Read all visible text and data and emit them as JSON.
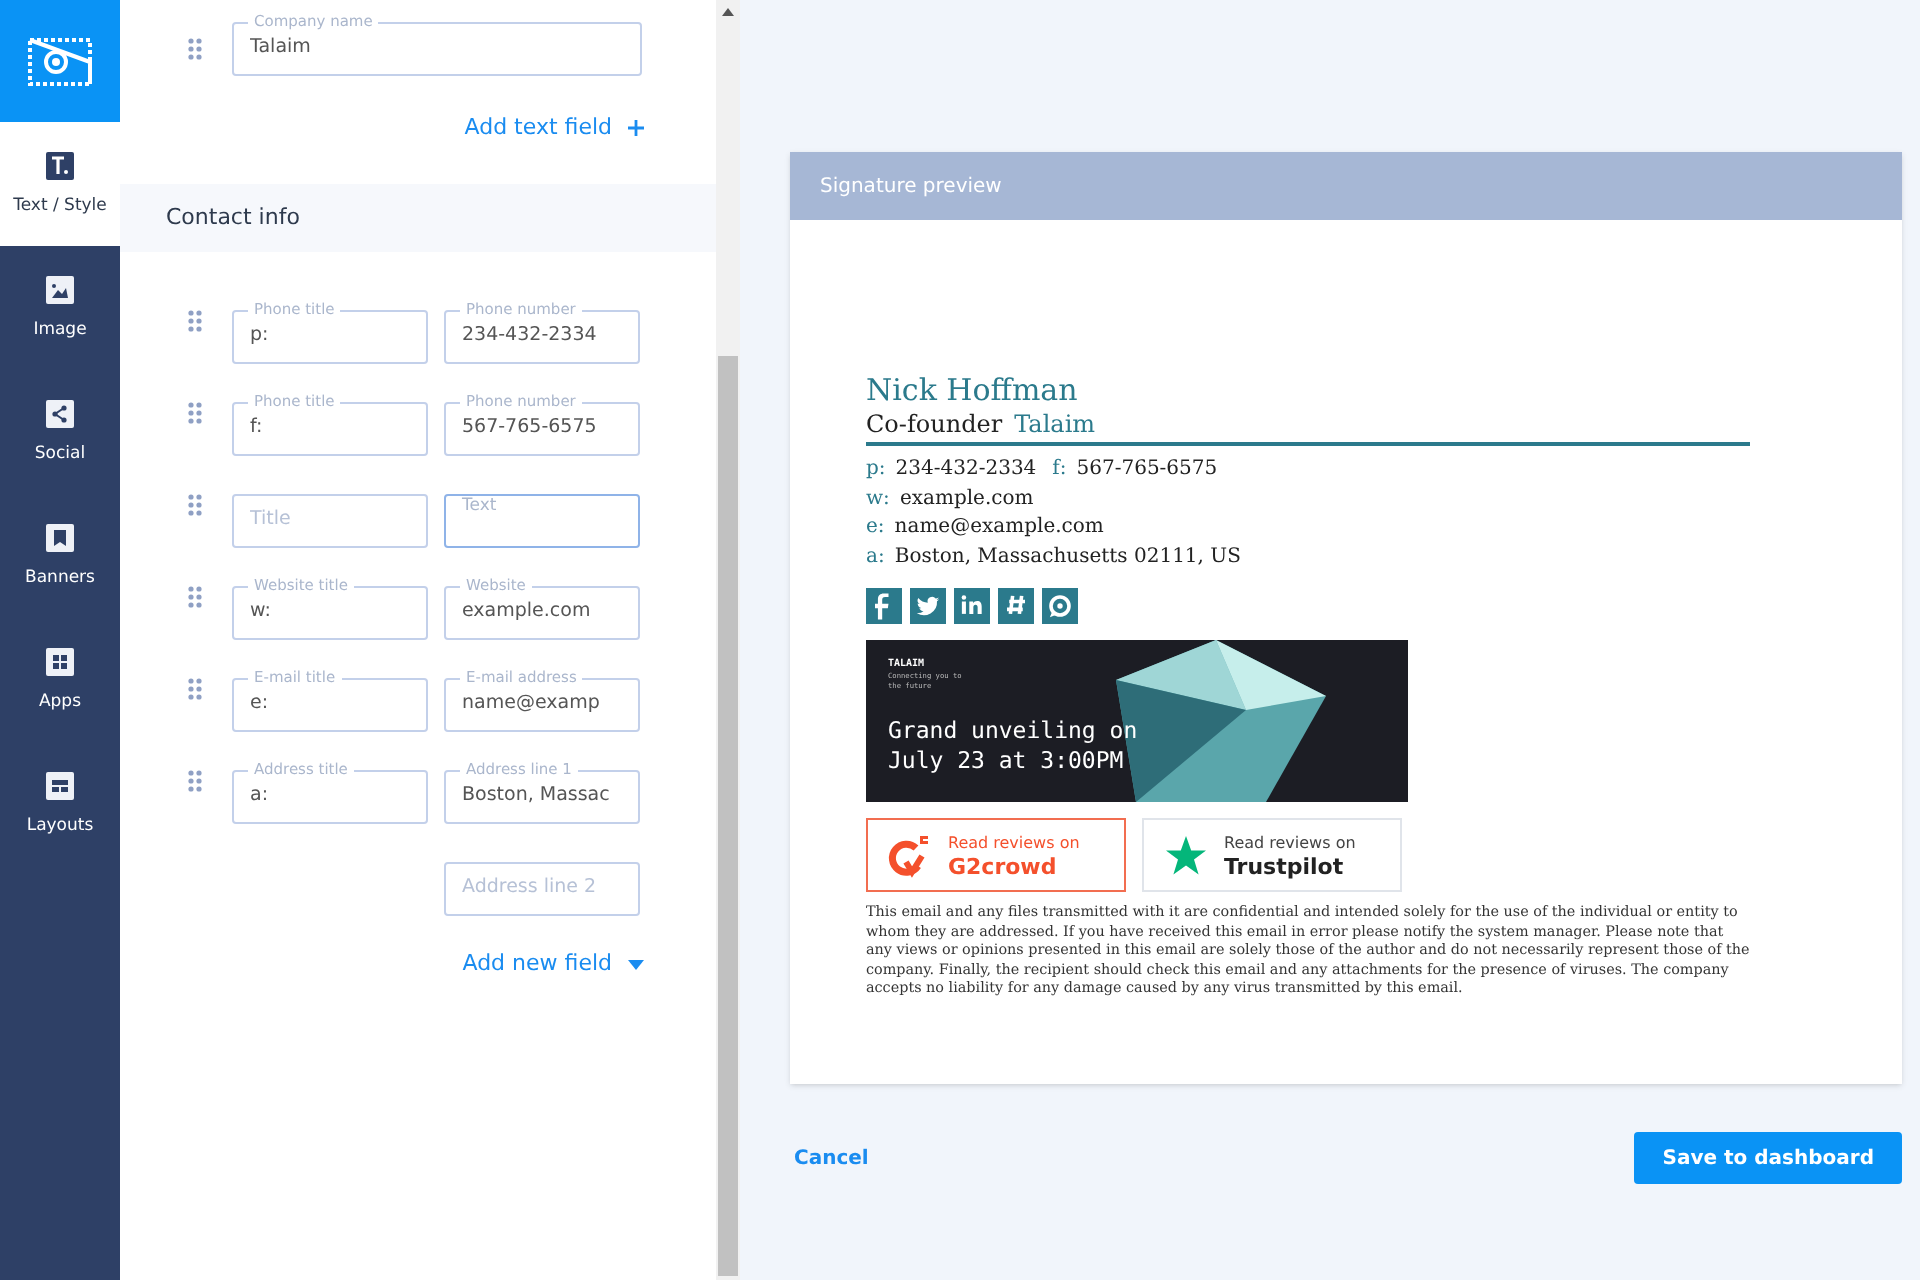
{
  "nav": [
    {
      "label": "Text / Style",
      "selected": true
    },
    {
      "label": "Image",
      "selected": false
    },
    {
      "label": "Social",
      "selected": false
    },
    {
      "label": "Banners",
      "selected": false
    },
    {
      "label": "Apps",
      "selected": false
    },
    {
      "label": "Layouts",
      "selected": false
    }
  ],
  "company_field": {
    "label": "Company name",
    "value": "Talaim"
  },
  "add_text_field": "Add text field",
  "section_title": "Contact info",
  "contact_rows": [
    {
      "kind": "pair",
      "left": {
        "label": "Phone title",
        "value": "p:"
      },
      "right": {
        "label": "Phone number",
        "value": "234-432-2334"
      }
    },
    {
      "kind": "pair",
      "left": {
        "label": "Phone title",
        "value": "f:"
      },
      "right": {
        "label": "Phone number",
        "value": "567-765-6575"
      }
    },
    {
      "kind": "pair",
      "left": {
        "placeholder": "Title",
        "focused": false
      },
      "right": {
        "label": "Text",
        "focused": true
      }
    },
    {
      "kind": "pair",
      "left": {
        "label": "Website title",
        "value": "w:"
      },
      "right": {
        "label": "Website",
        "value": "example.com"
      }
    },
    {
      "kind": "pair",
      "left": {
        "label": "E-mail title",
        "value": "e:"
      },
      "right": {
        "label": "E-mail address",
        "value": "name@examp"
      }
    },
    {
      "kind": "pair",
      "left": {
        "label": "Address title",
        "value": "a:"
      },
      "right": {
        "label": "Address line 1",
        "value": "Boston, Massac"
      }
    },
    {
      "kind": "continuation",
      "right": {
        "placeholder": "Address line 2"
      }
    }
  ],
  "add_new_field": "Add new field",
  "preview": {
    "header": "Signature preview",
    "name": "Nick Hoffman",
    "title": "Co-founder",
    "company": "Talaim",
    "contact_lines": [
      [
        {
          "k": "p:",
          "v": "234-432-2334"
        },
        {
          "k": "f:",
          "v": "567-765-6575"
        }
      ],
      [
        {
          "k": "w:",
          "v": "example.com"
        }
      ],
      [
        {
          "k": "e:",
          "v": "name@example.com"
        }
      ],
      [
        {
          "k": "a:",
          "v": "Boston, Massachusetts 02111, US"
        }
      ]
    ],
    "banner": {
      "brand": "TALAIM",
      "tagline": "Connecting you to the future",
      "headline": "Grand unveiling on July 23 at 3:00PM"
    },
    "reviews": [
      {
        "kind": "g2",
        "caption": "Read reviews on",
        "name": "G2crowd"
      },
      {
        "kind": "trustpilot",
        "caption": "Read reviews on",
        "name": "Trustpilot"
      }
    ],
    "disclaimer": "This email and any files transmitted with it are confidential and intended solely for the use of the individual or entity to whom they are addressed. If you have received this email in error please notify the system manager. Please note that any views or opinions presented in this email are solely those of the author and do not necessarily represent those of the company. Finally, the recipient should check this email and any attachments for the presence of viruses. The company accepts no liability for any damage caused by any virus transmitted by this email."
  },
  "cancel": "Cancel",
  "save": "Save to dashboard"
}
